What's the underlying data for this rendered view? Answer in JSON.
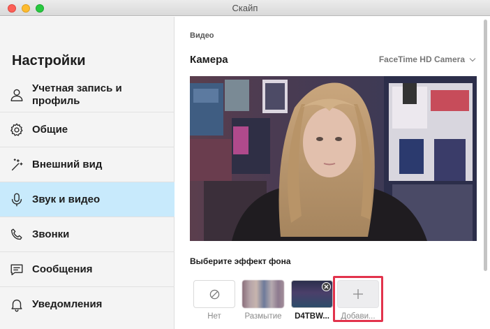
{
  "window": {
    "title": "Скайп"
  },
  "sidebar": {
    "title": "Настройки",
    "items": [
      {
        "label": "Учетная запись и профиль",
        "icon": "user-icon",
        "active": false
      },
      {
        "label": "Общие",
        "icon": "gear-icon",
        "active": false
      },
      {
        "label": "Внешний вид",
        "icon": "magic-wand-icon",
        "active": false
      },
      {
        "label": "Звук и видео",
        "icon": "microphone-icon",
        "active": true
      },
      {
        "label": "Звонки",
        "icon": "phone-icon",
        "active": false
      },
      {
        "label": "Сообщения",
        "icon": "message-icon",
        "active": false
      },
      {
        "label": "Уведомления",
        "icon": "bell-icon",
        "active": false
      }
    ]
  },
  "main": {
    "section_label": "Видео",
    "camera_label": "Камера",
    "camera_device": "FaceTime HD Camera",
    "effect_label": "Выберите эффект фона",
    "effects": [
      {
        "label": "Нет",
        "icon": "no-icon"
      },
      {
        "label": "Размытие"
      },
      {
        "label": "D4TBW..."
      },
      {
        "label": "Добави...",
        "icon": "plus-icon"
      }
    ]
  },
  "colors": {
    "active_nav": "#c8eafc",
    "highlight": "#e2334c"
  }
}
